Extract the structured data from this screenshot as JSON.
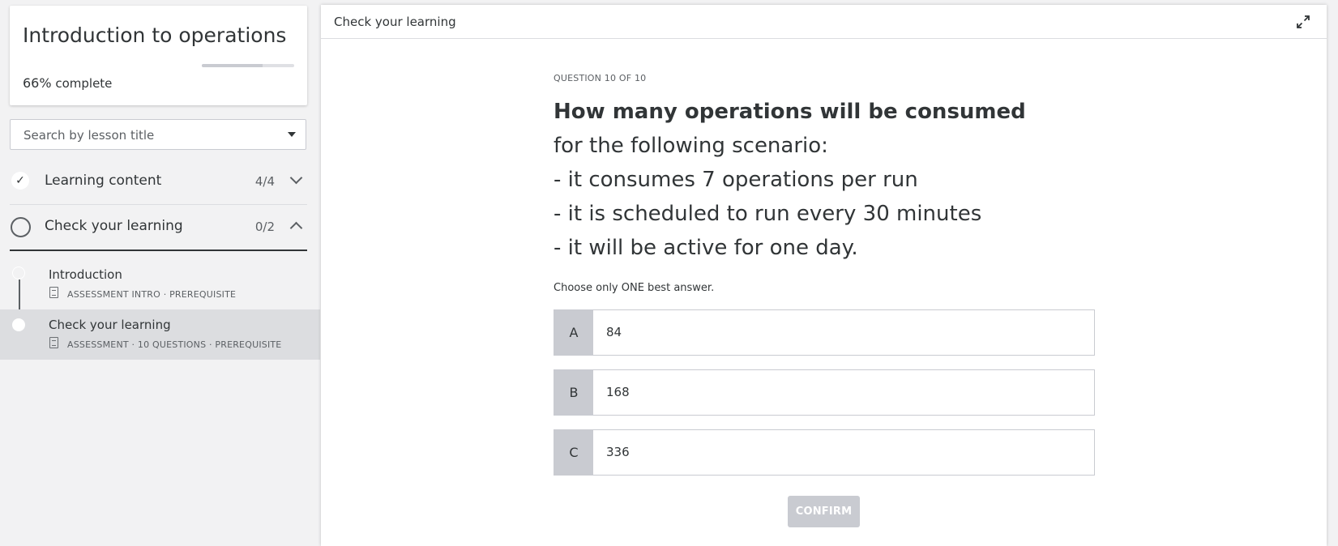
{
  "sidebar": {
    "course": {
      "title": "Introduction to operations",
      "progress_percent": "66%",
      "progress_label": "complete",
      "progress_value": 0.66
    },
    "search": {
      "placeholder": "Search by lesson title"
    },
    "sections": [
      {
        "title": "Learning content",
        "count": "4/4",
        "status": "completed",
        "expanded": false
      },
      {
        "title": "Check your learning",
        "count": "0/2",
        "status": "not-started",
        "expanded": true
      }
    ],
    "lessons": [
      {
        "title": "Introduction",
        "type": "ASSESSMENT INTRO",
        "tag": "PREREQUISITE",
        "active": false
      },
      {
        "title": "Check your learning",
        "type": "ASSESSMENT",
        "questions": "10 QUESTIONS",
        "tag": "PREREQUISITE",
        "active": true
      }
    ]
  },
  "main": {
    "header_title": "Check your learning",
    "question_number": "QUESTION 10 OF 10",
    "question_bold": "How many operations will be consumed",
    "question_rest": " for the following scenario:",
    "question_lines": [
      "- it consumes 7 operations per run",
      "- it is scheduled to run every 30 minutes",
      "- it will be active for one day."
    ],
    "instruction": "Choose only ONE best answer.",
    "options": [
      {
        "letter": "A",
        "value": "84"
      },
      {
        "letter": "B",
        "value": "168"
      },
      {
        "letter": "C",
        "value": "336"
      }
    ],
    "confirm_label": "CONFIRM"
  },
  "colors": {
    "text": "#313537",
    "muted": "#5c6064",
    "option_letter_bg": "#c9cbd1",
    "active_lesson_bg": "#dcdde0",
    "page_bg": "#f2f2f3"
  },
  "icons": {
    "check": "✓",
    "expand": "expand-icon"
  }
}
